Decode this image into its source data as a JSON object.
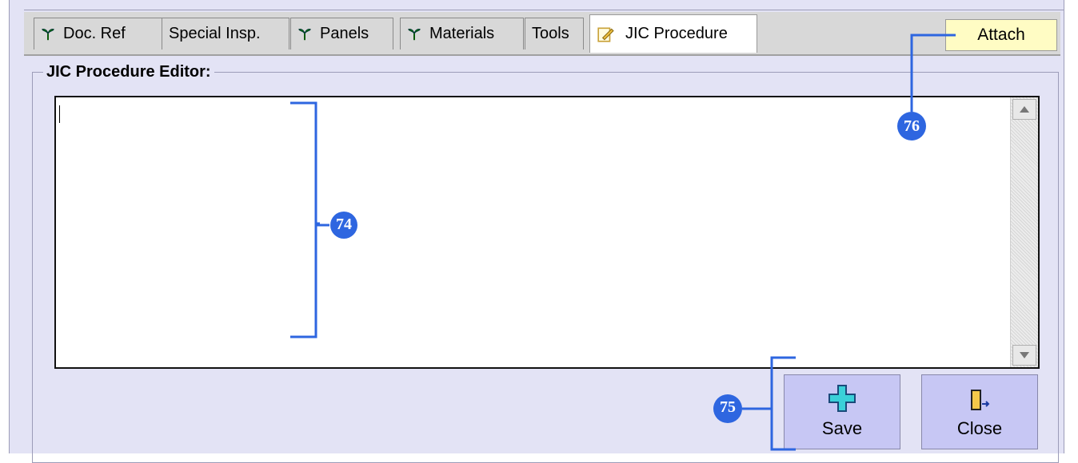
{
  "tabs": [
    {
      "label": "Doc. Ref",
      "icon": "leaf-icon"
    },
    {
      "label": "Special Insp.",
      "icon": ""
    },
    {
      "label": "Panels",
      "icon": "leaf-icon"
    },
    {
      "label": "Materials",
      "icon": "leaf-icon"
    },
    {
      "label": "Tools",
      "icon": ""
    },
    {
      "label": "JIC Procedure",
      "icon": "edit-document-icon",
      "active": true
    }
  ],
  "attach_label": "Attach",
  "editor": {
    "title": "JIC Procedure Editor:",
    "value": ""
  },
  "buttons": {
    "save_label": "Save",
    "close_label": "Close"
  },
  "callouts": {
    "editor": "74",
    "buttons": "75",
    "attach": "76"
  },
  "colors": {
    "panel": "#e3e3f5",
    "attach_bg": "#fffcc4",
    "button_bg": "#c7c7f4",
    "callout": "#2e66e0"
  }
}
